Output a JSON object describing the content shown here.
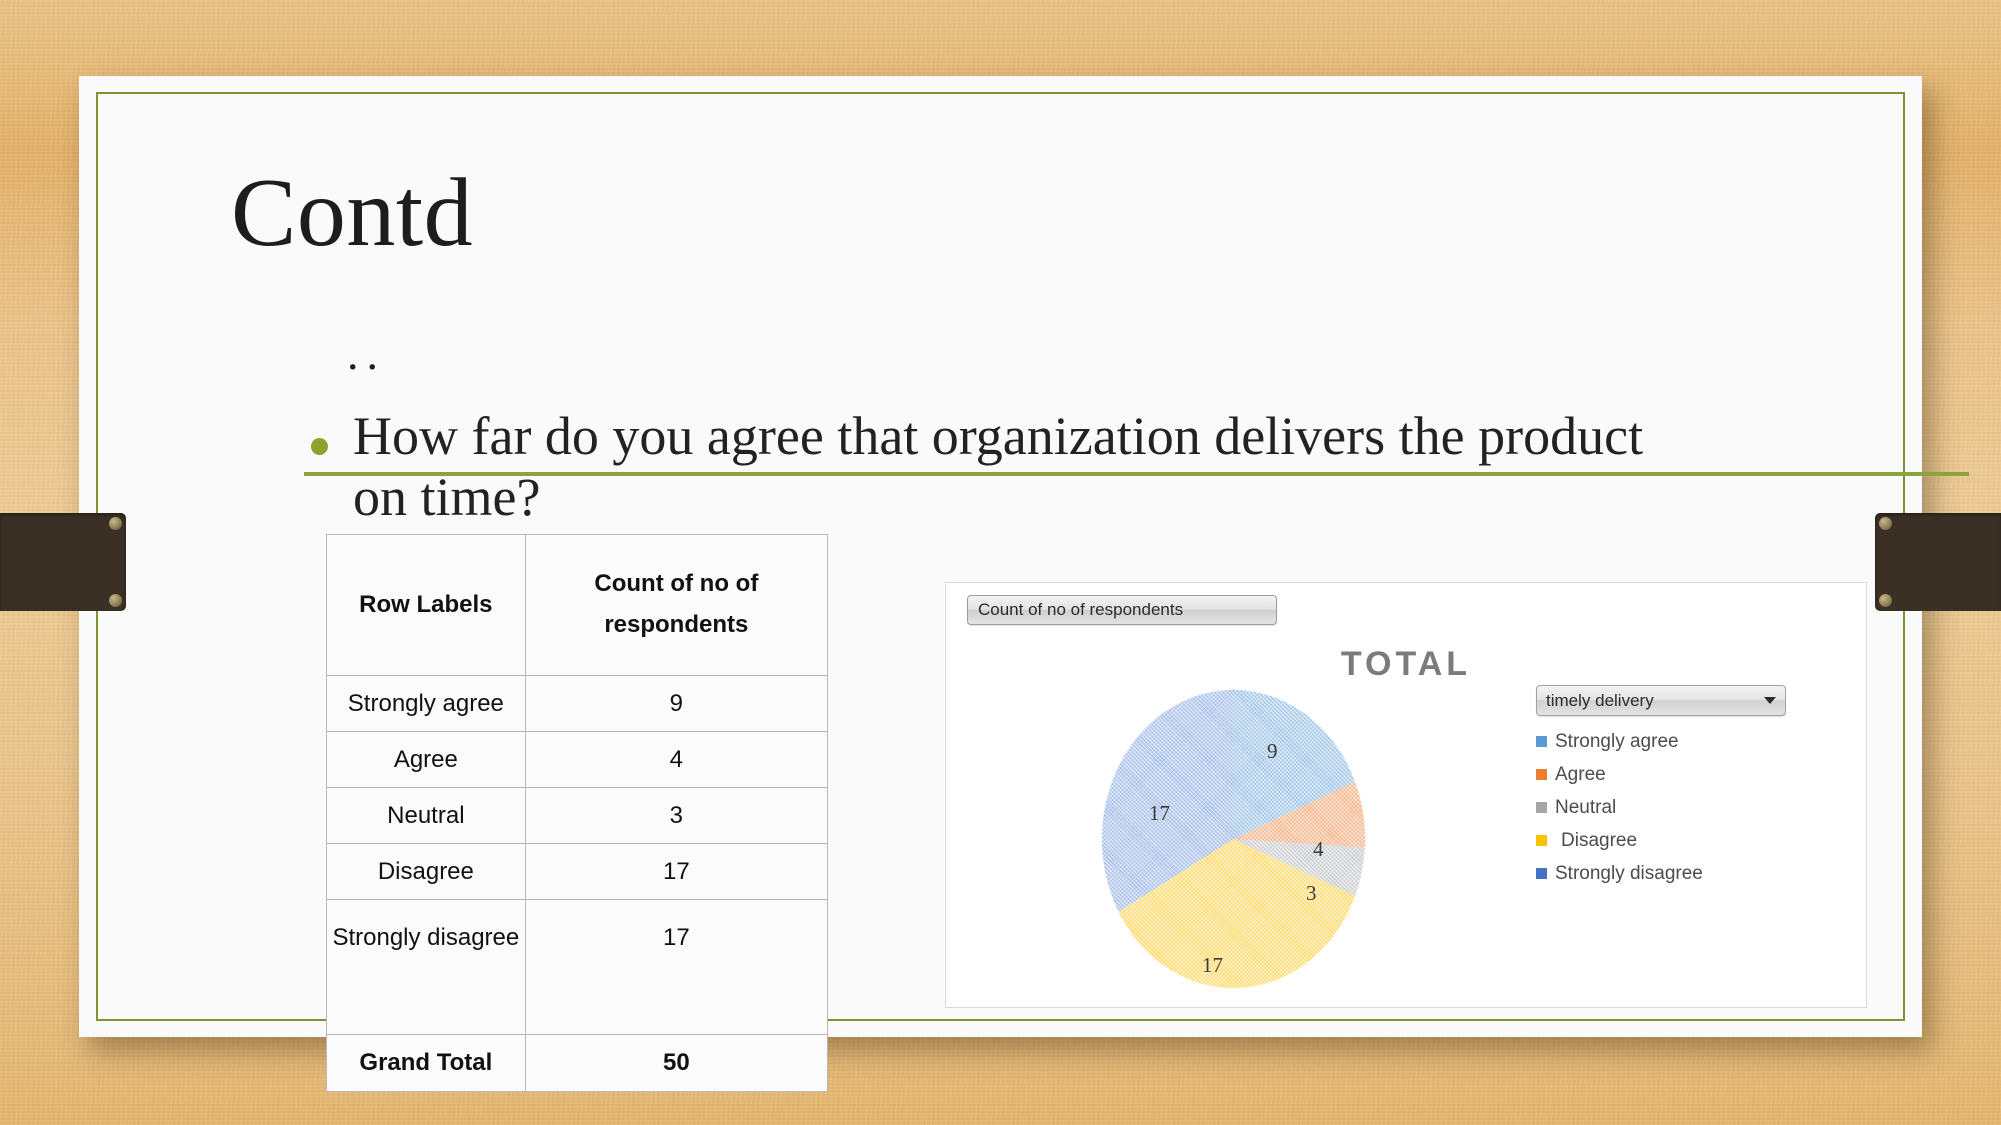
{
  "slide": {
    "title": "Contd",
    "dots_line": "..",
    "question": "How far do you agree that organization delivers the product on time?",
    "accent_color": "#8aa32b",
    "border_color": "#7d9434"
  },
  "table": {
    "headers": [
      "Row Labels",
      "Count of no of respondents"
    ],
    "rows": [
      {
        "label": "Strongly agree",
        "value": "9"
      },
      {
        "label": "Agree",
        "value": "4"
      },
      {
        "label": "Neutral",
        "value": "3"
      },
      {
        "label": "Disagree",
        "value": "17"
      },
      {
        "label": "Strongly disagree",
        "value": "17"
      }
    ],
    "total": {
      "label": "Grand Total",
      "value": "50"
    }
  },
  "chart": {
    "field_button_label": "Count of no of respondents",
    "title": "TOTAL",
    "legend_button_label": "timely delivery",
    "legend": [
      {
        "label": "Strongly agree",
        "color": "#5B9BD5"
      },
      {
        "label": "Agree",
        "color": "#ED7D31"
      },
      {
        "label": "Neutral",
        "color": "#A5A5A5"
      },
      {
        "label": "Disagree",
        "color": "#FFC000"
      },
      {
        "label": "Strongly disagree",
        "color": "#4472C4"
      }
    ]
  },
  "chart_data": {
    "type": "pie",
    "title": "TOTAL",
    "series_name": "Count of no of respondents",
    "category_field": "timely delivery",
    "categories": [
      "Strongly agree",
      "Agree",
      "Neutral",
      "Disagree",
      "Strongly disagree"
    ],
    "values": [
      9,
      4,
      3,
      17,
      17
    ],
    "total": 50,
    "data_labels": [
      "9",
      "4",
      "3",
      "17",
      "17"
    ],
    "colors": [
      "#9DC3E6",
      "#F4B183",
      "#C9CBCE",
      "#FFD966",
      "#A3BCE8"
    ],
    "legend_position": "right",
    "grid": false
  }
}
